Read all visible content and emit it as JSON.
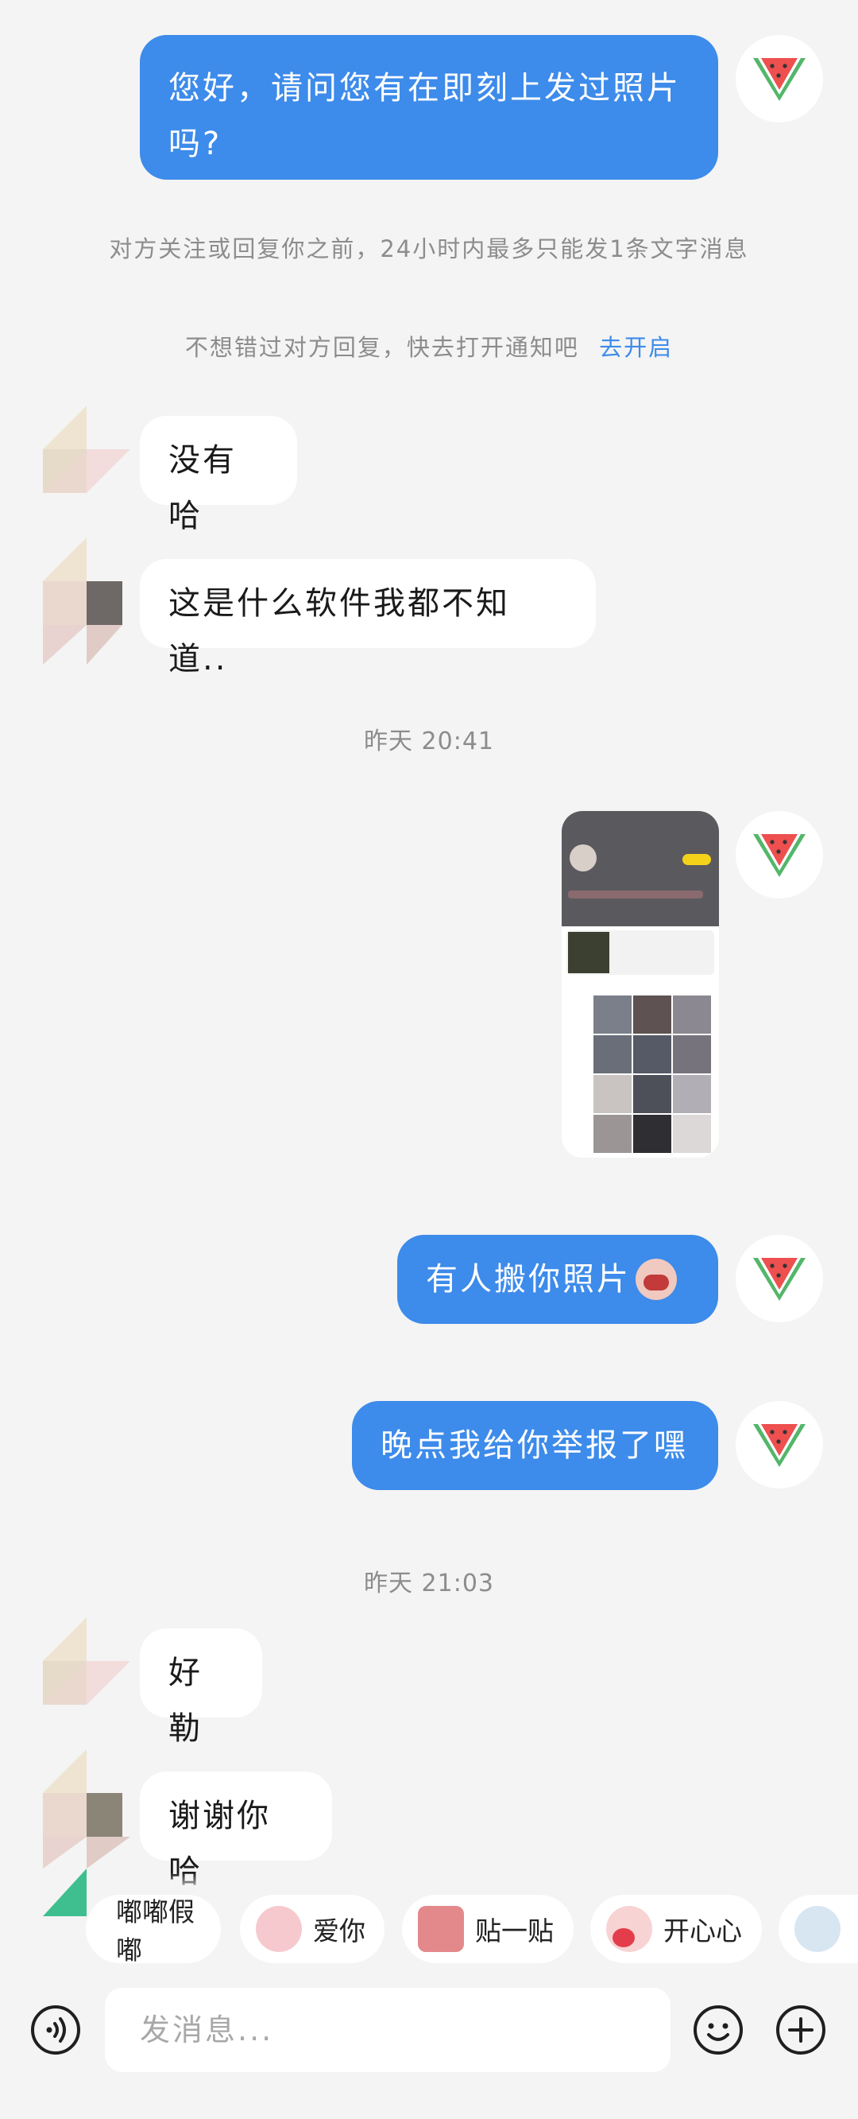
{
  "messages": {
    "m1": "您好，请问您有在即刻上发过照片吗?",
    "m1_line1": "您好，请问您有在即刻上发过照片",
    "m1_line2": "吗?",
    "notice1": "对方关注或回复你之前，24小时内最多只能发1条文字消息",
    "notice2_text": "不想错过对方回复，快去打开通知吧",
    "notice2_link": "去开启",
    "m2": "没有哈",
    "m3": "这是什么软件我都不知道..",
    "time1": "昨天 20:41",
    "m5": "有人搬你照片",
    "m6": "晚点我给你举报了嘿",
    "time2": "昨天 21:03",
    "m7": "好勒",
    "m8": "谢谢你哈"
  },
  "quick_replies": [
    "嘟嘟假嘟",
    "爱你",
    "贴一贴",
    "开心心"
  ],
  "input": {
    "placeholder": "发消息..."
  },
  "icons": {
    "voice": "voice-icon",
    "emoji": "emoji-icon",
    "plus": "plus-icon",
    "self_avatar": "watermelon-avatar"
  },
  "colors": {
    "outgoing": "#3d8bea",
    "incoming": "#ffffff",
    "background": "#f4f4f4",
    "link": "#3d8bea"
  }
}
